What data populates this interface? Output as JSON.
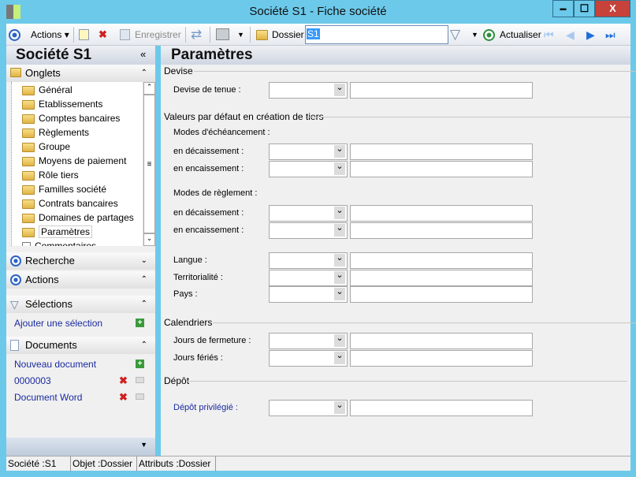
{
  "window": {
    "title": "Société S1 -  Fiche société",
    "minimize": "▬",
    "maximize": "☐",
    "close": "X"
  },
  "toolbar": {
    "actions": "Actions",
    "save": "Enregistrer",
    "dossier": "Dossier",
    "search_value": "S1",
    "refresh": "Actualiser"
  },
  "left": {
    "title": "Société S1",
    "collapse": "«",
    "onglets": "Onglets",
    "tree": [
      "Général",
      "Etablissements",
      "Comptes bancaires",
      "Règlements",
      "Groupe",
      "Moyens de paiement",
      "Rôle tiers",
      "Familles société",
      "Contrats bancaires",
      "Domaines de partages",
      "Paramètres",
      "Commentaires"
    ],
    "recherche": "Recherche",
    "actions": "Actions",
    "selections": "Sélections",
    "add_selection": "Ajouter une sélection",
    "documents": "Documents",
    "new_document": "Nouveau document",
    "docs": [
      "0000003",
      "Document Word"
    ]
  },
  "main": {
    "title": "Paramètres",
    "devise": "Devise",
    "devise_tenue": "Devise de tenue :",
    "valeurs": "Valeurs par défaut en création de tiers",
    "modes_ech": "Modes d'échéancement :",
    "en_dec": "en décaissement :",
    "en_enc": "en encaissement :",
    "modes_reg": "Modes de règlement :",
    "langue": "Langue :",
    "territorialite": "Territorialité :",
    "pays": "Pays :",
    "calendriers": "Calendriers",
    "jours_fermeture": "Jours de fermeture :",
    "jours_feries": "Jours fériés :",
    "depot": "Dépôt",
    "depot_priv": "Dépôt privilégié  :"
  },
  "status": {
    "societe": "Société :S1",
    "objet": "Objet :Dossier",
    "attributs": "Attributs :Dossier"
  }
}
